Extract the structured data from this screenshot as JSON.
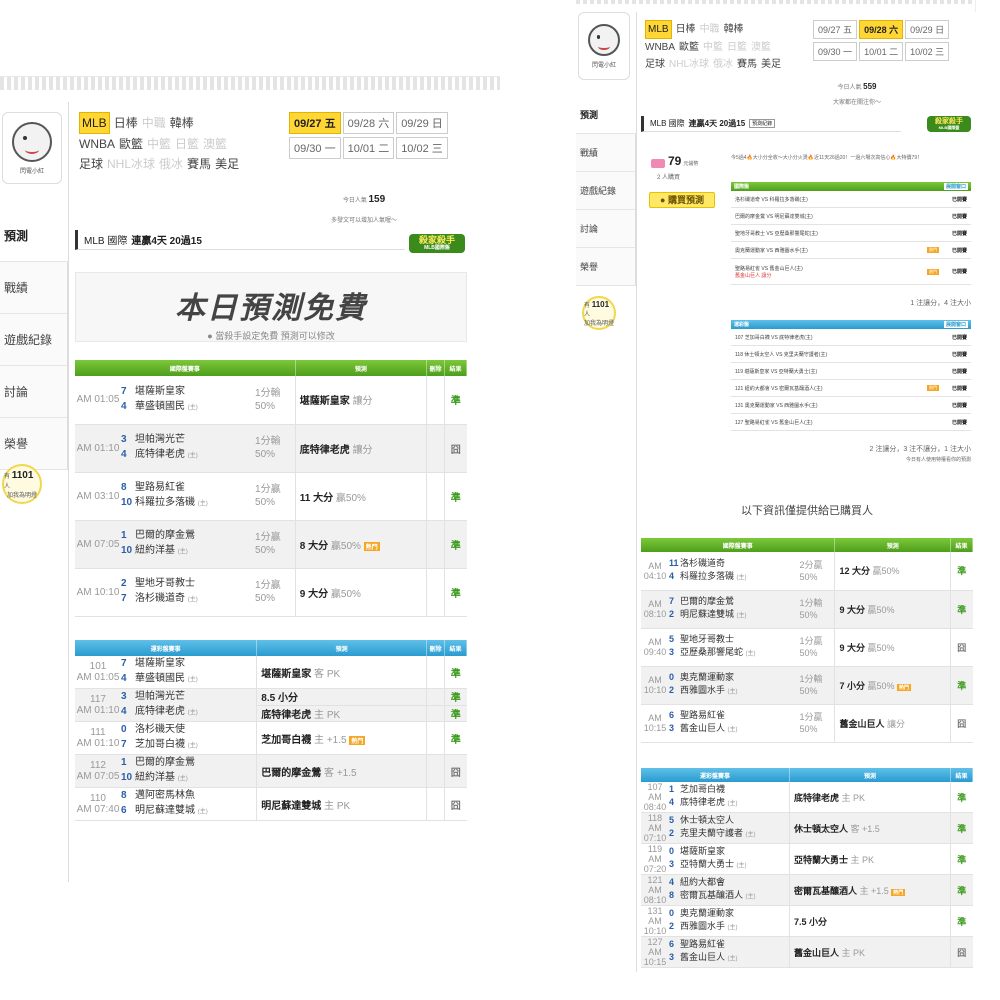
{
  "left": {
    "mascot_label": "閃電小紅",
    "sidebar": [
      "預測",
      "戰績",
      "遊戲紀錄",
      "討論",
      "榮譽"
    ],
    "bulb": {
      "count": "1101",
      "unit": "人",
      "line1": "有",
      "line2": "加我為明燈"
    },
    "leagues": {
      "row1": [
        {
          "t": "MLB",
          "s": "sel"
        },
        {
          "t": "日棒",
          "s": ""
        },
        {
          "t": "中職",
          "s": "dim"
        },
        {
          "t": "韓棒",
          "s": ""
        }
      ],
      "row2": [
        {
          "t": "WNBA",
          "s": ""
        },
        {
          "t": "歐籃",
          "s": ""
        },
        {
          "t": "中籃",
          "s": "dim"
        },
        {
          "t": "日籃",
          "s": "dim"
        },
        {
          "t": "澳籃",
          "s": "dim"
        }
      ],
      "row3": [
        {
          "t": "足球",
          "s": ""
        },
        {
          "t": "NHL冰球",
          "s": "dim"
        },
        {
          "t": "俄冰",
          "s": "dim"
        },
        {
          "t": "賽馬",
          "s": ""
        },
        {
          "t": "美足",
          "s": ""
        }
      ]
    },
    "dates": {
      "row1": [
        {
          "d": "09/27",
          "w": "五",
          "sel": true
        },
        {
          "d": "09/28",
          "w": "六",
          "sel": false
        },
        {
          "d": "09/29",
          "w": "日",
          "sel": false
        }
      ],
      "row2": [
        {
          "d": "09/30",
          "w": "一",
          "sel": false
        },
        {
          "d": "10/01",
          "w": "二",
          "sel": false
        },
        {
          "d": "10/02",
          "w": "三",
          "sel": false
        }
      ]
    },
    "popularity": {
      "label": "今日人氣",
      "value": "159",
      "hint": "多發文可以增加人氣喔～"
    },
    "record": {
      "prefix": "MLB 國際",
      "streak": "連贏4天 20過15"
    },
    "badge": {
      "line1": "殺家殺手",
      "line2": "MLB國際盤"
    },
    "free": {
      "title": "本日預測免費",
      "sub": "當殺手設定免費 預測可以修改"
    },
    "intl_header": [
      "國際盤賽事",
      "預測",
      "刪除",
      "結果"
    ],
    "intl_rows": [
      {
        "time": "AM 01:05",
        "a_no": "7",
        "a": "堪薩斯皇家",
        "b_no": "4",
        "b": "華盛頓國民",
        "b_tag": "(主)",
        "odds1": "1分輸",
        "odds2": "50%",
        "pred": "堪薩斯皇家",
        "pred_sub": "讓分",
        "hot": "",
        "res": "準"
      },
      {
        "time": "AM 01:10",
        "a_no": "3",
        "a": "坦帕灣光芒",
        "b_no": "4",
        "b": "底特律老虎",
        "b_tag": "(主)",
        "odds1": "1分輸",
        "odds2": "50%",
        "pred": "底特律老虎",
        "pred_sub": "讓分",
        "hot": "",
        "res": "囧"
      },
      {
        "time": "AM 03:10",
        "a_no": "8",
        "a": "聖路易紅雀",
        "b_no": "10",
        "b": "科羅拉多落磯",
        "b_tag": "(主)",
        "odds1": "1分贏",
        "odds2": "50%",
        "pred": "11 大分",
        "pred_sub": "贏50%",
        "hot": "",
        "res": "準"
      },
      {
        "time": "AM 07:05",
        "a_no": "1",
        "a": "巴爾的摩金鶯",
        "b_no": "10",
        "b": "紐約洋基",
        "b_tag": "(主)",
        "odds1": "1分贏",
        "odds2": "50%",
        "pred": "8 大分",
        "pred_sub": "贏50%",
        "hot": "熱門",
        "res": "準"
      },
      {
        "time": "AM 10:10",
        "a_no": "2",
        "a": "聖地牙哥教士",
        "b_no": "7",
        "b": "洛杉磯道奇",
        "b_tag": "(主)",
        "odds1": "1分贏",
        "odds2": "50%",
        "pred": "9 大分",
        "pred_sub": "贏50%",
        "hot": "",
        "res": "準"
      }
    ],
    "sport_header": [
      "運彩盤賽事",
      "預測",
      "刪除",
      "結果"
    ],
    "sport_rows": [
      {
        "no": "101",
        "time": "AM 01:05",
        "a_no": "7",
        "a": "堪薩斯皇家",
        "b_no": "4",
        "b": "華盛頓國民",
        "b_tag": "(主)",
        "pred": "堪薩斯皇家",
        "pred_sub": "客 PK",
        "hot": "",
        "res": "準"
      },
      {
        "no": "117",
        "time": "AM 01:10",
        "a_no": "3",
        "a": "坦帕灣光芒",
        "b_no": "4",
        "b": "底特律老虎",
        "b_tag": "(主)",
        "pred": "8.5 小分",
        "pred_sub": "",
        "hot": "",
        "res": "準",
        "pred2": "底特律老虎",
        "pred2_sub": "主 PK",
        "res2": "準"
      },
      {
        "no": "111",
        "time": "AM 01:10",
        "a_no": "0",
        "a": "洛杉磯天使",
        "b_no": "7",
        "b": "芝加哥白襪",
        "b_tag": "(主)",
        "pred": "芝加哥白襪",
        "pred_sub": "主 +1.5",
        "hot": "熱門",
        "res": "準"
      },
      {
        "no": "112",
        "time": "AM 07:05",
        "a_no": "1",
        "a": "巴爾的摩金鶯",
        "b_no": "10",
        "b": "紐約洋基",
        "b_tag": "(主)",
        "pred": "巴爾的摩金鶯",
        "pred_sub": "客 +1.5",
        "hot": "",
        "res": "囧"
      },
      {
        "no": "110",
        "time": "AM 07:40",
        "a_no": "8",
        "a": "邁阿密馬林魚",
        "b_no": "6",
        "b": "明尼蘇達雙城",
        "b_tag": "(主)",
        "pred": "明尼蘇達雙城",
        "pred_sub": "主 PK",
        "hot": "",
        "res": "囧"
      }
    ]
  },
  "right": {
    "mascot_label": "閃電小紅",
    "sidebar": [
      "預測",
      "戰績",
      "遊戲紀錄",
      "討論",
      "榮譽"
    ],
    "bulb": {
      "count": "1101",
      "unit": "人",
      "line1": "有",
      "line2": "加我為明燈"
    },
    "leagues": {
      "row1": [
        {
          "t": "MLB",
          "s": "sel"
        },
        {
          "t": "日棒",
          "s": ""
        },
        {
          "t": "中職",
          "s": "dim"
        },
        {
          "t": "韓棒",
          "s": ""
        }
      ],
      "row2": [
        {
          "t": "WNBA",
          "s": ""
        },
        {
          "t": "歐籃",
          "s": ""
        },
        {
          "t": "中籃",
          "s": "dim"
        },
        {
          "t": "日籃",
          "s": "dim"
        },
        {
          "t": "澳籃",
          "s": "dim"
        }
      ],
      "row3": [
        {
          "t": "足球",
          "s": ""
        },
        {
          "t": "NHL冰球",
          "s": "dim"
        },
        {
          "t": "俄冰",
          "s": "dim"
        },
        {
          "t": "賽馬",
          "s": ""
        },
        {
          "t": "美足",
          "s": ""
        }
      ]
    },
    "dates": {
      "row1": [
        {
          "d": "09/27",
          "w": "五",
          "sel": false
        },
        {
          "d": "09/28",
          "w": "六",
          "sel": true
        },
        {
          "d": "09/29",
          "w": "日",
          "sel": false
        }
      ],
      "row2": [
        {
          "d": "09/30",
          "w": "一",
          "sel": false
        },
        {
          "d": "10/01",
          "w": "二",
          "sel": false
        },
        {
          "d": "10/02",
          "w": "三",
          "sel": false
        }
      ]
    },
    "popularity": {
      "label": "今日人氣",
      "value": "559",
      "hint": "大家都在關注你～"
    },
    "record": {
      "prefix": "MLB 國際",
      "streak": "連贏4天 20過15",
      "tag": "預測紀錄"
    },
    "badge": {
      "line1": "殺家殺手",
      "line2": "MLB國際盤"
    },
    "coin": {
      "value": "79",
      "unit": "元儲幣",
      "buyers": "2 人購買"
    },
    "buy_button": "購買預測",
    "notice": "今5過4🔥大小分全收～大小分火燙🔥近11天26過20！一過六場次高信心🔥大特價79！",
    "intl_box": {
      "title": "國際盤",
      "expand": "展開窗口",
      "rows": [
        {
          "t": "洛杉磯道奇 VS 科羅拉多落磯(主)",
          "hot": "",
          "s": "已開賽"
        },
        {
          "t": "巴爾的摩金鶯 VS 明尼蘇達雙城(主)",
          "hot": "",
          "s": "已開賽"
        },
        {
          "t": "聖地牙哥教士 VS 亞歷桑那響尾蛇(主)",
          "hot": "",
          "s": "已開賽"
        },
        {
          "t": "奧克蘭運動家 VS 西雅圖水手(主)",
          "hot": "熱門",
          "s": "已開賽"
        },
        {
          "t": "聖路易紅雀 VS 舊金山巨人(主)",
          "hot": "熱門",
          "s": "已開賽",
          "sub": "舊金山巨人 讓分"
        }
      ],
      "summary": "1 注讓分，4 注大小"
    },
    "sport_box": {
      "title": "運彩盤",
      "expand": "展開窗口",
      "rows": [
        {
          "t": "107  芝加哥白襪 VS 底特律老虎(主)",
          "hot": "",
          "s": "已開賽"
        },
        {
          "t": "118  休士頓太空人 VS 克里夫蘭守護者(主)",
          "hot": "",
          "s": "已開賽"
        },
        {
          "t": "119  堪薩斯皇家 VS 亞特蘭大勇士(主)",
          "hot": "",
          "s": "已開賽"
        },
        {
          "t": "121  紐約大都會 VS 密爾瓦基釀酒人(主)",
          "hot": "熱門",
          "s": "已開賽"
        },
        {
          "t": "131  奧克蘭運動家 VS 西雅圖水手(主)",
          "hot": "",
          "s": "已開賽"
        },
        {
          "t": "127  聖路易紅雀 VS 舊金山巨人(主)",
          "hot": "",
          "s": "已開賽"
        }
      ],
      "summary": "2 注讓分，3 注不讓分，1 注大小",
      "hint": "今日有人使用特權看你的預測"
    },
    "info_text": "以下資訊僅提供給已購買人",
    "intl_header": [
      "國際盤賽事",
      "預測",
      "結果"
    ],
    "intl_rows": [
      {
        "time": "AM 04:10",
        "a_no": "11",
        "a": "洛杉磯道奇",
        "b_no": "4",
        "b": "科羅拉多落磯",
        "b_tag": "(主)",
        "odds1": "2分贏",
        "odds2": "50%",
        "pred": "12 大分",
        "pred_sub": "贏50%",
        "hot": "",
        "res": "準"
      },
      {
        "time": "AM 08:10",
        "a_no": "7",
        "a": "巴爾的摩金鶯",
        "b_no": "2",
        "b": "明尼蘇達雙城",
        "b_tag": "(主)",
        "odds1": "1分輸",
        "odds2": "50%",
        "pred": "9 大分",
        "pred_sub": "贏50%",
        "hot": "",
        "res": "準"
      },
      {
        "time": "AM 09:40",
        "a_no": "5",
        "a": "聖地牙哥教士",
        "b_no": "3",
        "b": "亞歷桑那響尾蛇",
        "b_tag": "(主)",
        "odds1": "1分贏",
        "odds2": "50%",
        "pred": "9 大分",
        "pred_sub": "贏50%",
        "hot": "",
        "res": "囧"
      },
      {
        "time": "AM 10:10",
        "a_no": "0",
        "a": "奧克蘭運動家",
        "b_no": "2",
        "b": "西雅圖水手",
        "b_tag": "(主)",
        "odds1": "1分輸",
        "odds2": "50%",
        "pred": "7 小分",
        "pred_sub": "贏50%",
        "hot": "熱門",
        "res": "準"
      },
      {
        "time": "AM 10:15",
        "a_no": "6",
        "a": "聖路易紅雀",
        "b_no": "3",
        "b": "舊金山巨人",
        "b_tag": "(主)",
        "odds1": "1分贏",
        "odds2": "50%",
        "pred": "舊金山巨人",
        "pred_sub": "讓分",
        "hot": "",
        "res": "囧"
      }
    ],
    "sport_header": [
      "運彩盤賽事",
      "預測",
      "結果"
    ],
    "sport_rows": [
      {
        "no": "107",
        "time": "AM 08:40",
        "a_no": "1",
        "a": "芝加哥白襪",
        "b_no": "4",
        "b": "底特律老虎",
        "b_tag": "(主)",
        "pred": "底特律老虎",
        "pred_sub": "主 PK",
        "hot": "",
        "res": "準"
      },
      {
        "no": "118",
        "time": "AM 07:10",
        "a_no": "5",
        "a": "休士頓太空人",
        "b_no": "2",
        "b": "克里夫蘭守護者",
        "b_tag": "(主)",
        "pred": "休士頓太空人",
        "pred_sub": "客 +1.5",
        "hot": "",
        "res": "準"
      },
      {
        "no": "119",
        "time": "AM 07:20",
        "a_no": "0",
        "a": "堪薩斯皇家",
        "b_no": "3",
        "b": "亞特蘭大勇士",
        "b_tag": "(主)",
        "pred": "亞特蘭大勇士",
        "pred_sub": "主 PK",
        "hot": "",
        "res": "準"
      },
      {
        "no": "121",
        "time": "AM 08:10",
        "a_no": "4",
        "a": "紐約大都會",
        "b_no": "8",
        "b": "密爾瓦基釀酒人",
        "b_tag": "(主)",
        "pred": "密爾瓦基釀酒人",
        "pred_sub": "主 +1.5",
        "hot": "熱門",
        "res": "準"
      },
      {
        "no": "131",
        "time": "AM 10:10",
        "a_no": "0",
        "a": "奧克蘭運動家",
        "b_no": "2",
        "b": "西雅圖水手",
        "b_tag": "(主)",
        "pred": "7.5 小分",
        "pred_sub": "",
        "hot": "",
        "res": "準"
      },
      {
        "no": "127",
        "time": "AM 10:15",
        "a_no": "6",
        "a": "聖路易紅雀",
        "b_no": "3",
        "b": "舊金山巨人",
        "b_tag": "(主)",
        "pred": "舊金山巨人",
        "pred_sub": "主 PK",
        "hot": "",
        "res": "囧"
      }
    ]
  }
}
